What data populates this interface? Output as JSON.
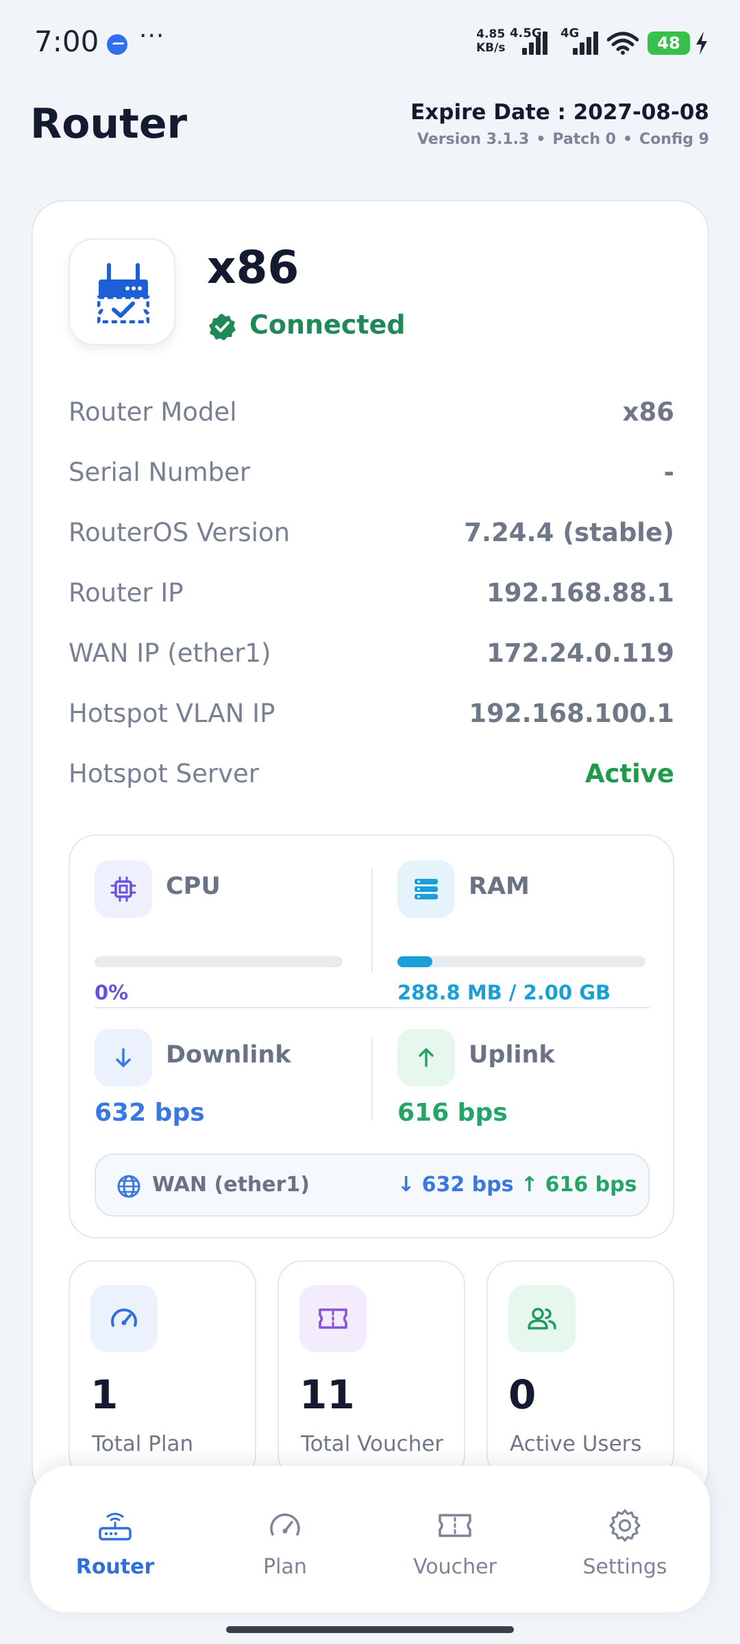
{
  "status_bar": {
    "time": "7:00",
    "network_speed_value": "4.85",
    "network_speed_unit": "KB/s",
    "net_type_1": "4.5G",
    "net_type_2": "4G",
    "battery": "48",
    "icons": [
      "messenger-icon",
      "more-dots-icon",
      "signal-icon",
      "wifi-icon",
      "battery-icon",
      "charging-icon"
    ]
  },
  "header": {
    "title": "Router",
    "expire": "Expire Date : 2027-08-08",
    "version": "Version 3.1.3",
    "patch": "Patch 0",
    "config": "Config 9",
    "separator": "•"
  },
  "router": {
    "name": "x86",
    "status": "Connected",
    "status_color": "#1f8a55",
    "icon": "router-icon"
  },
  "info": [
    {
      "label": "Router Model",
      "value": "x86"
    },
    {
      "label": "Serial Number",
      "value": "-"
    },
    {
      "label": "RouterOS Version",
      "value": "7.24.4 (stable)"
    },
    {
      "label": "Router IP",
      "value": "192.168.88.1"
    },
    {
      "label": "WAN IP (ether1)",
      "value": "172.24.0.119"
    },
    {
      "label": "Hotspot VLAN IP",
      "value": "192.168.100.1"
    },
    {
      "label": "Hotspot Server",
      "value": "Active"
    }
  ],
  "stats": {
    "cpu": {
      "title": "CPU",
      "value_text": "0%",
      "usage_fraction": 0.0,
      "color": "#6a4fe0"
    },
    "ram": {
      "title": "RAM",
      "value_text": "288.8 MB / 2.00 GB",
      "usage_fraction": 0.141,
      "color": "#1a9fd8"
    },
    "downlink": {
      "title": "Downlink",
      "value": "632 bps",
      "color": "#3878e0"
    },
    "uplink": {
      "title": "Uplink",
      "value": "616 bps",
      "color": "#22a566"
    },
    "wan": {
      "label": "WAN (ether1)",
      "down": "632 bps",
      "up": "616 bps"
    }
  },
  "summary": [
    {
      "number": "1",
      "label": "Total Plan",
      "icon": "speedometer-icon",
      "color": "#2f6fdd"
    },
    {
      "number": "11",
      "label": "Total Voucher",
      "icon": "ticket-icon",
      "color": "#8a4fe0"
    },
    {
      "number": "0",
      "label": "Active Users",
      "icon": "users-icon",
      "color": "#1f9a5e"
    }
  ],
  "nav": [
    {
      "label": "Router",
      "icon": "router-icon",
      "active": true
    },
    {
      "label": "Plan",
      "icon": "speedometer-icon",
      "active": false
    },
    {
      "label": "Voucher",
      "icon": "ticket-icon",
      "active": false
    },
    {
      "label": "Settings",
      "icon": "gear-icon",
      "active": false
    }
  ],
  "colors": {
    "accent": "#2f6fdd",
    "active_green": "#1f9a4a",
    "background": "#f1f4f9"
  }
}
